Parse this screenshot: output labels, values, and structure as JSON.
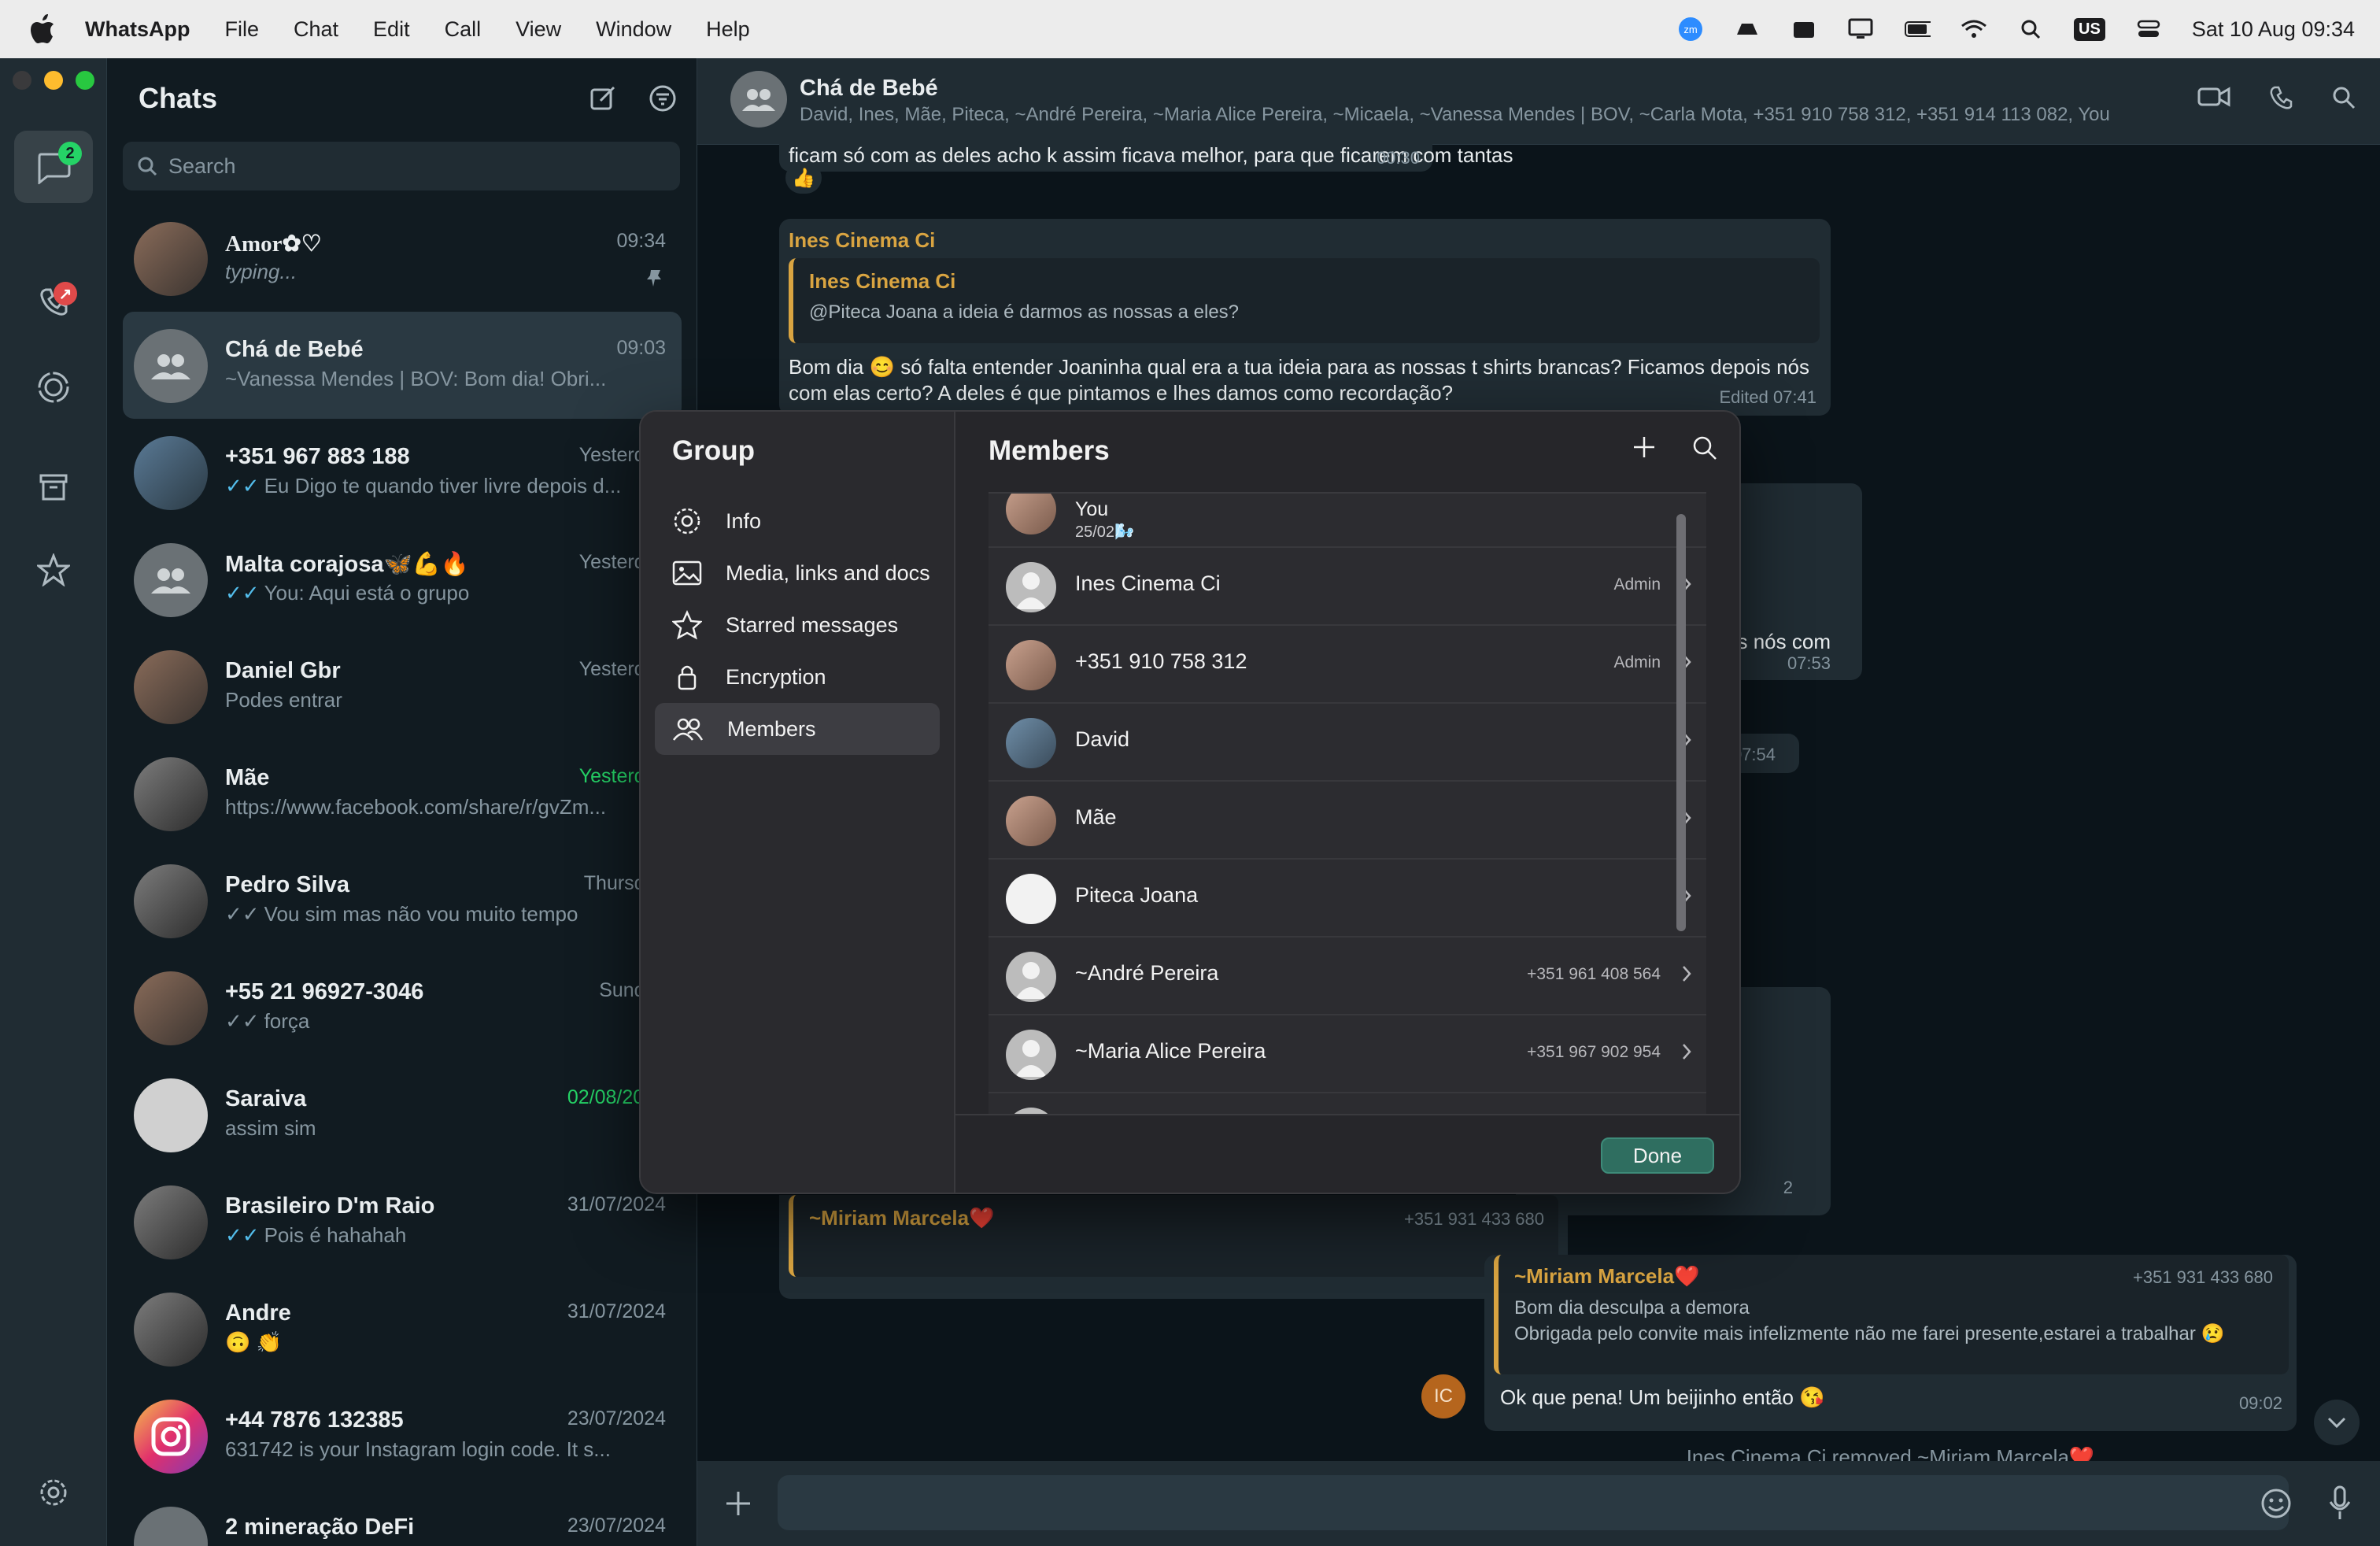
{
  "menubar": {
    "app": "WhatsApp",
    "items": [
      "File",
      "Chat",
      "Edit",
      "Call",
      "View",
      "Window",
      "Help"
    ],
    "keyboard": "US",
    "datetime": "Sat 10 Aug  09:34"
  },
  "rail": {
    "chats_badge": "2"
  },
  "chatlist": {
    "title": "Chats",
    "search_placeholder": "Search",
    "chats": [
      {
        "name": "Amor✿♡",
        "msg": "typing...",
        "time": "09:34"
      },
      {
        "name": "Chá de Bebé",
        "msg": "~Vanessa Mendes | BOV: Bom dia! Obri...",
        "time": "09:03"
      },
      {
        "name": "+351 967 883 188",
        "msg": "Eu Digo te quando tiver livre depois d...",
        "time": "Yesterday"
      },
      {
        "name": "Malta corajosa🦋💪🔥",
        "msg": "You: Aqui está o grupo",
        "time": "Yesterday"
      },
      {
        "name": "Daniel Gbr",
        "msg": "Podes entrar",
        "time": "Yesterday"
      },
      {
        "name": "Mãe",
        "msg": "https://www.facebook.com/share/r/gvZm...",
        "time": "Yesterday"
      },
      {
        "name": "Pedro Silva",
        "msg": "Vou sim mas não vou muito tempo",
        "time": "Thursday"
      },
      {
        "name": "+55 21 96927-3046",
        "msg": "força",
        "time": "Sunday"
      },
      {
        "name": "Saraiva",
        "msg": "assim sim",
        "time": "02/08/2024"
      },
      {
        "name": "Brasileiro D'm Raio",
        "msg": "Pois é hahahah",
        "time": "31/07/2024"
      },
      {
        "name": "Andre",
        "msg": "🙃 👏",
        "time": "31/07/2024"
      },
      {
        "name": "+44 7876 132385",
        "msg": "631742 is your Instagram login code. It s...",
        "time": "23/07/2024"
      },
      {
        "name": "2 mineração DeFi",
        "msg": "",
        "time": "23/07/2024"
      }
    ]
  },
  "conversation": {
    "title": "Chá de Bebé",
    "subtitle": "David, Ines, Mãe, Piteca, ~André Pereira, ~Maria Alice Pereira, ~Micaela, ~Vanessa Mendes | BOV, ~Carla Mota, +351 910 758 312, +351 914 113 082, You",
    "top_msg": "ficam só com as deles acho k assim ficava melhor, para que ficarem com tantas",
    "top_time": "00:30",
    "top_reaction": "👍",
    "msg1": {
      "sender": "Ines Cinema Ci",
      "quote_sender": "Ines Cinema Ci",
      "quote_text": "@Piteca Joana a ideia é darmos as nossas a eles?",
      "text": "Bom dia 😊 só falta entender Joaninha qual era a tua ideia para as nossas t shirts brancas? Ficamos depois nós com elas certo? A deles é que pintamos e lhes damos como recordação?",
      "meta": "Edited  07:41"
    },
    "partial1": "s nós com",
    "partial1_time": "07:53",
    "partial2_time": "07:54",
    "partial3": "2",
    "msg2": {
      "quote_sender": "~Miriam Marcela❤️",
      "quote_phone": "+351 931 433 680",
      "quote_text1": "Bom dia desculpa a demora",
      "quote_text2": "Obrigada pelo convite mais infelizmente não me farei presente,estarei a trabalhar 😢",
      "text": "Ok que pena! Um beijinho então 😘",
      "time": "09:02",
      "avatar_initials": "IC"
    },
    "system": "Ines Cinema Ci removed ~Miriam Marcela❤️"
  },
  "dialog": {
    "left_title": "Group",
    "menu": [
      {
        "label": "Info"
      },
      {
        "label": "Media, links and docs"
      },
      {
        "label": "Starred messages"
      },
      {
        "label": "Encryption"
      },
      {
        "label": "Members"
      }
    ],
    "right_title": "Members",
    "you": {
      "name": "You",
      "status": "25/02🌬️"
    },
    "members": [
      {
        "name": "Ines Cinema Ci",
        "role": "Admin"
      },
      {
        "name": "+351 910 758 312",
        "role": "Admin"
      },
      {
        "name": "David",
        "role": ""
      },
      {
        "name": "Mãe",
        "role": ""
      },
      {
        "name": "Piteca Joana",
        "role": ""
      },
      {
        "name": "~André Pereira",
        "role": "+351 961 408 564"
      },
      {
        "name": "~Maria Alice Pereira",
        "role": "+351 967 902 954"
      }
    ],
    "done_label": "Done"
  }
}
